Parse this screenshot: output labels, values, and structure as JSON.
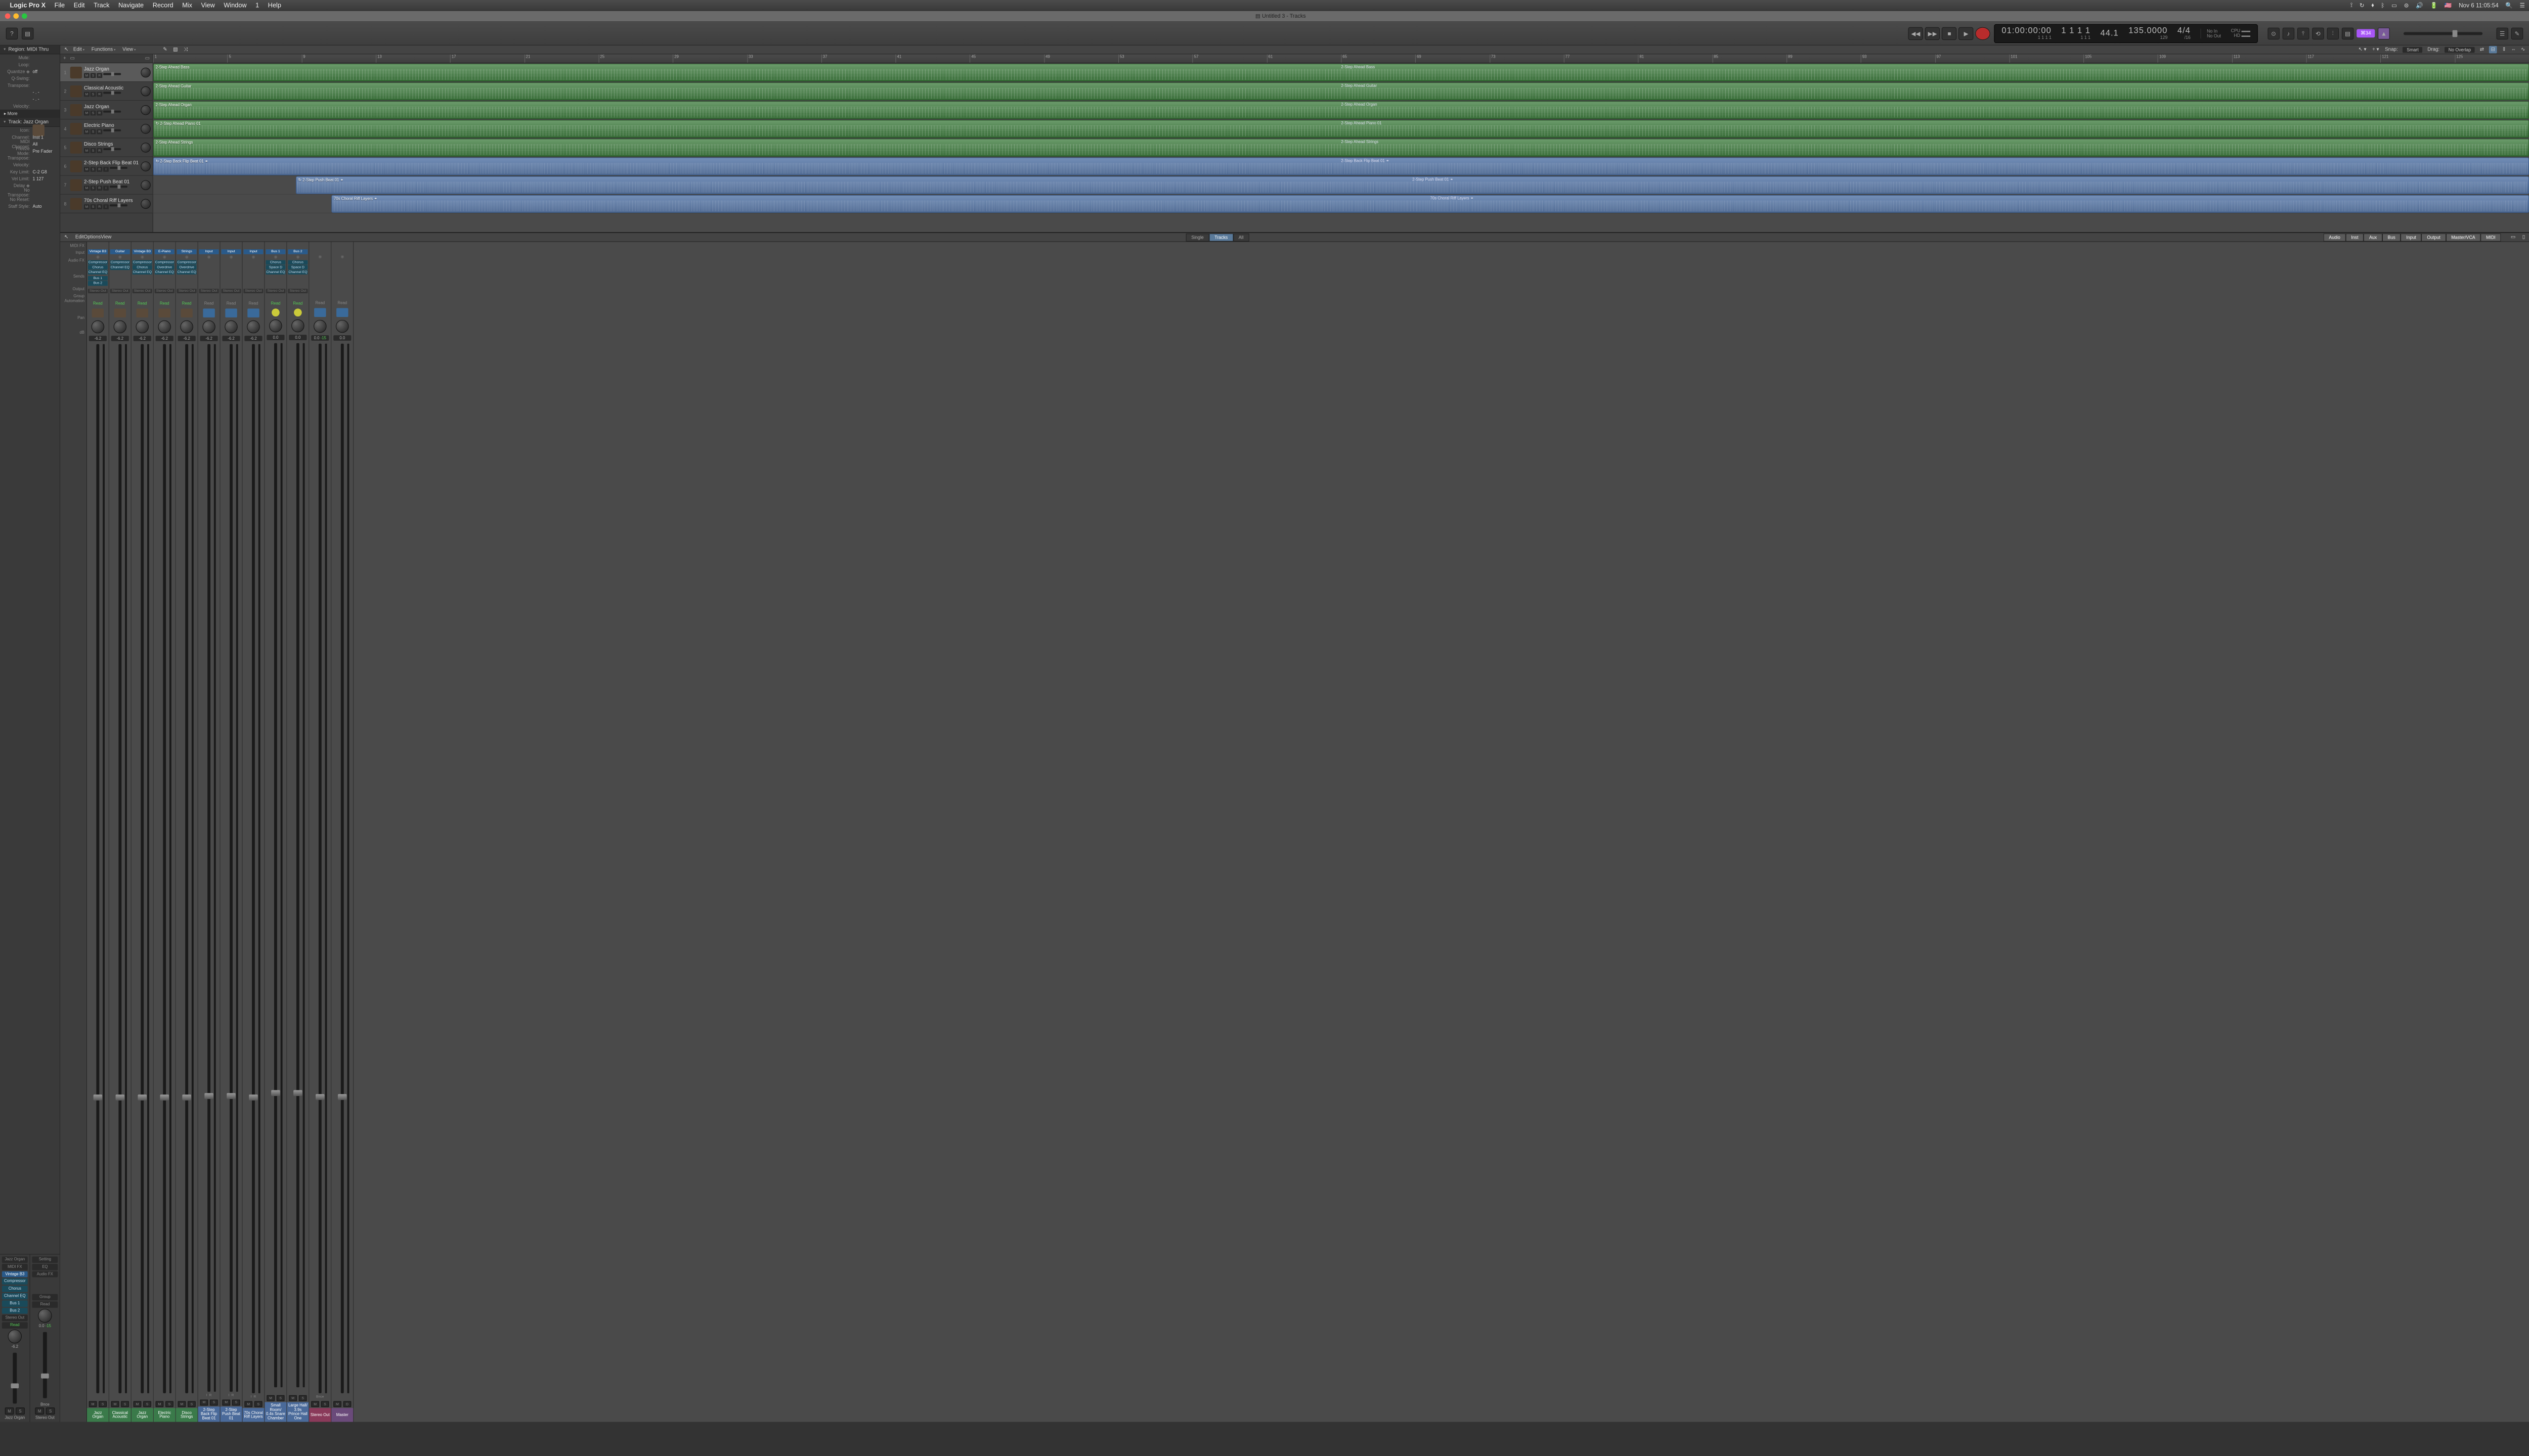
{
  "menubar": {
    "app": "Logic Pro X",
    "items": [
      "File",
      "Edit",
      "Track",
      "Navigate",
      "Record",
      "Mix",
      "View",
      "Window",
      "1",
      "Help"
    ],
    "clock": "Nov 6  11:05:54"
  },
  "title": "Untitled 3 - Tracks",
  "transport": {
    "time": "01:00:00:00",
    "pos": "1   1   1   1",
    "bars": "1   1   1   1",
    "bars2": "1     1     1",
    "tempo_a": "44.1",
    "tempo_b": "135.0000",
    "sig": "4/4",
    "div": "/16",
    "key": "129",
    "noin": "No In",
    "noout": "No Out"
  },
  "badge": "⌘34",
  "inspector": {
    "region_hdr": "Region: MIDI Thru",
    "region": [
      {
        "k": "Mute:",
        "v": ""
      },
      {
        "k": "Loop:",
        "v": ""
      },
      {
        "k": "Quantize ◈",
        "v": "off"
      },
      {
        "k": "Q-Swing:",
        "v": ""
      },
      {
        "k": "Transpose:",
        "v": ""
      },
      {
        "k": "",
        "v": "- . -"
      },
      {
        "k": "",
        "v": "- . -"
      },
      {
        "k": "Velocity:",
        "v": ""
      }
    ],
    "more": "▸ More",
    "track_hdr": "Track: Jazz Organ",
    "track": [
      {
        "k": "Icon:",
        "v": ""
      },
      {
        "k": "Channel:",
        "v": "Inst 1"
      },
      {
        "k": "MIDI Channel:",
        "v": "All"
      },
      {
        "k": "Freeze Mode:",
        "v": "Pre Fader"
      },
      {
        "k": "Transpose:",
        "v": ""
      },
      {
        "k": "Velocity:",
        "v": ""
      },
      {
        "k": "Key Limit:",
        "v": "C-2    G8"
      },
      {
        "k": "Vel Limit:",
        "v": "1    127"
      },
      {
        "k": "Delay ◈",
        "v": ""
      },
      {
        "k": "No Transpose:",
        "v": ""
      },
      {
        "k": "No Reset:",
        "v": ""
      },
      {
        "k": "Staff Style:",
        "v": "Auto"
      }
    ],
    "strip1": {
      "name": "Jazz Organ",
      "setting": "Setting",
      "midifx": "MIDI FX",
      "input": "Vintage B3",
      "fx": [
        "Compressor",
        "Chorus",
        "Channel EQ"
      ],
      "sends": [
        "Bus 1",
        "Bus 2"
      ],
      "out": "Stereo Out",
      "read": "Read",
      "db": "-6.2",
      "M": "M",
      "S": "S",
      "label": "Jazz Organ"
    },
    "strip2": {
      "name": "Stereo Out",
      "eq": "EQ",
      "audiofx": "Audio FX",
      "group": "Group",
      "read": "Read",
      "db": "0.0",
      "peak": "-15",
      "bnce": "Bnce",
      "M": "M",
      "S": "S",
      "label": "Stereo Out"
    }
  },
  "tracks_hdr": {
    "edit": "Edit",
    "functions": "Functions",
    "view": "View",
    "snap": "Snap:",
    "snapv": "Smart",
    "drag": "Drag:",
    "dragv": "No Overlap"
  },
  "ruler": [
    1,
    5,
    9,
    13,
    17,
    21,
    25,
    29,
    33,
    37,
    41,
    45,
    49,
    53,
    57,
    61,
    65,
    69,
    73,
    77,
    81,
    85,
    89,
    93,
    97,
    101,
    105,
    109,
    113,
    117,
    121,
    125
  ],
  "tracks": [
    {
      "n": 1,
      "name": "Jazz Organ",
      "btns": [
        "M",
        "S",
        "R"
      ],
      "sel": true
    },
    {
      "n": 2,
      "name": "Classical Acoustic",
      "btns": [
        "M",
        "S",
        "R"
      ]
    },
    {
      "n": 3,
      "name": "Jazz Organ",
      "btns": [
        "M",
        "S",
        "R"
      ]
    },
    {
      "n": 4,
      "name": "Electric Piano",
      "btns": [
        "M",
        "S",
        "R"
      ]
    },
    {
      "n": 5,
      "name": "Disco Strings",
      "btns": [
        "M",
        "S",
        "R"
      ]
    },
    {
      "n": 6,
      "name": "2-Step Back Flip Beat 01",
      "btns": [
        "M",
        "S",
        "R",
        "I"
      ]
    },
    {
      "n": 7,
      "name": "2-Step Push Beat 01",
      "btns": [
        "M",
        "S",
        "R",
        "I"
      ]
    },
    {
      "n": 8,
      "name": "70s Choral Riff Layers",
      "btns": [
        "M",
        "S",
        "R",
        "I"
      ]
    }
  ],
  "regions": [
    {
      "row": 0,
      "type": "midi",
      "l": "2-Step Ahead Bass",
      "l2": "2-Step Ahead Bass",
      "x": 0,
      "w": 100
    },
    {
      "row": 1,
      "type": "midi",
      "l": "2-Step Ahead Guitar",
      "l2": "2-Step Ahead Guitar",
      "x": 0,
      "w": 100
    },
    {
      "row": 2,
      "type": "midi",
      "l": "2-Step Ahead Organ",
      "l2": "2-Step Ahead Organ",
      "x": 0,
      "w": 100
    },
    {
      "row": 3,
      "type": "midi",
      "l": "↻ 2-Step Ahead Piano 01",
      "l2": "2-Step Ahead Piano 01",
      "x": 0,
      "w": 100
    },
    {
      "row": 4,
      "type": "midi",
      "l": "2-Step Ahead Strings",
      "l2": "2-Step Ahead Strings",
      "x": 0,
      "w": 100
    },
    {
      "row": 5,
      "type": "audio",
      "l": "↻ 2-Step Back Flip Beat 01  ⚭",
      "l2": "2-Step Back Flip Beat 01  ⚭",
      "x": 0,
      "w": 100
    },
    {
      "row": 6,
      "type": "audio",
      "l": "↻ 2-Step Push Beat 01  ⚭",
      "l2": "2-Step Push Beat 01  ⚭",
      "x": 6,
      "w": 94
    },
    {
      "row": 7,
      "type": "audio",
      "l": "70s Choral Riff Layers  ⚭",
      "l2": "70s Choral Riff Layers  ⚭",
      "x": 7.5,
      "w": 92.5
    }
  ],
  "mixer": {
    "menus": [
      "Edit",
      "Options",
      "View"
    ],
    "center": [
      "Single",
      "Tracks",
      "All"
    ],
    "right": [
      "Audio",
      "Inst",
      "Aux",
      "Bus",
      "Input",
      "Output",
      "Master/VCA",
      "MIDI"
    ],
    "labels": [
      "MIDI FX",
      "Input",
      "Audio FX",
      "Sends",
      "Output",
      "Group",
      "Automation",
      "",
      "Pan",
      "dB"
    ],
    "strips": [
      {
        "in": "Vintage B3",
        "fx": [
          "Compressor",
          "Chorus",
          "Channel EQ"
        ],
        "sends": [
          "Bus 1",
          "Bus 2"
        ],
        "out": "Stereo Out",
        "read": "Read",
        "db": "-6.2",
        "ms": [
          "M",
          "S"
        ],
        "label": "Jazz Organ",
        "col": "gr",
        "icon": "inst"
      },
      {
        "in": "Guitar",
        "fx": [
          "Compressor",
          "Channel EQ"
        ],
        "out": "Stereo Out",
        "read": "Read",
        "db": "-6.2",
        "ms": [
          "M",
          "S"
        ],
        "label": "Classical Acoustic",
        "col": "gr",
        "icon": "inst"
      },
      {
        "in": "Vintage B3",
        "fx": [
          "Compressor",
          "Chorus",
          "Channel EQ"
        ],
        "out": "Stereo Out",
        "read": "Read",
        "db": "-6.2",
        "ms": [
          "M",
          "S"
        ],
        "label": "Jazz Organ",
        "col": "gr",
        "icon": "inst"
      },
      {
        "in": "E-Piano",
        "fx": [
          "Compressor",
          "Overdrive",
          "Channel EQ"
        ],
        "out": "Stereo Out",
        "read": "Read",
        "db": "-6.2",
        "ms": [
          "M",
          "S"
        ],
        "label": "Electric Piano",
        "col": "gr",
        "icon": "inst"
      },
      {
        "in": "Strings",
        "fx": [
          "Compressor",
          "Overdrive",
          "Channel EQ"
        ],
        "out": "Stereo Out",
        "read": "Read",
        "db": "-6.2",
        "ms": [
          "M",
          "S"
        ],
        "label": "Disco Strings",
        "col": "gr",
        "icon": "inst"
      },
      {
        "in": "Input",
        "out": "Stereo Out",
        "read": "Read",
        "db": "-6.2",
        "ir": [
          "I",
          "R"
        ],
        "ms": [
          "M",
          "S"
        ],
        "label": "2-Step Back Flip Beat 01",
        "col": "bl",
        "icon": "wave"
      },
      {
        "in": "Input",
        "out": "Stereo Out",
        "read": "Read",
        "db": "-6.2",
        "ir": [
          "I",
          "R"
        ],
        "ms": [
          "M",
          "S"
        ],
        "label": "2-Step Push Beat 01",
        "col": "bl",
        "icon": "wave"
      },
      {
        "in": "Input",
        "out": "Stereo Out",
        "read": "Read",
        "db": "-6.2",
        "ir": [
          "I",
          "R"
        ],
        "ms": [
          "M",
          "S"
        ],
        "label": "70s Choral Riff Layers",
        "col": "bl",
        "icon": "wave"
      },
      {
        "in": "Bus 1",
        "fx": [
          "Chorus",
          "Space D",
          "Channel EQ"
        ],
        "out": "Stereo Out",
        "read": "Read",
        "db": "0.0",
        "ms": [
          "M",
          "S"
        ],
        "label": "Small Room/ 0.4s Snare Chamber",
        "col": "bl",
        "icon": "yel"
      },
      {
        "in": "Bus 2",
        "fx": [
          "Chorus",
          "Space D",
          "Channel EQ"
        ],
        "out": "Stereo Out",
        "read": "Read",
        "db": "0.0",
        "ms": [
          "M",
          "S"
        ],
        "label": "Large Hall/ 3.9s Prince Hall One",
        "col": "bl",
        "icon": "yel"
      },
      {
        "read": "Read",
        "db": "0.0",
        "peak": "-15",
        "bnce": "Bnce",
        "ms": [
          "M",
          "S"
        ],
        "label": "Stereo Out",
        "col": "rd",
        "icon": "wave"
      },
      {
        "read": "Read",
        "db": "0.0",
        "ms": [
          "M",
          "D"
        ],
        "label": "Master",
        "col": "pp",
        "icon": "wave"
      }
    ]
  }
}
